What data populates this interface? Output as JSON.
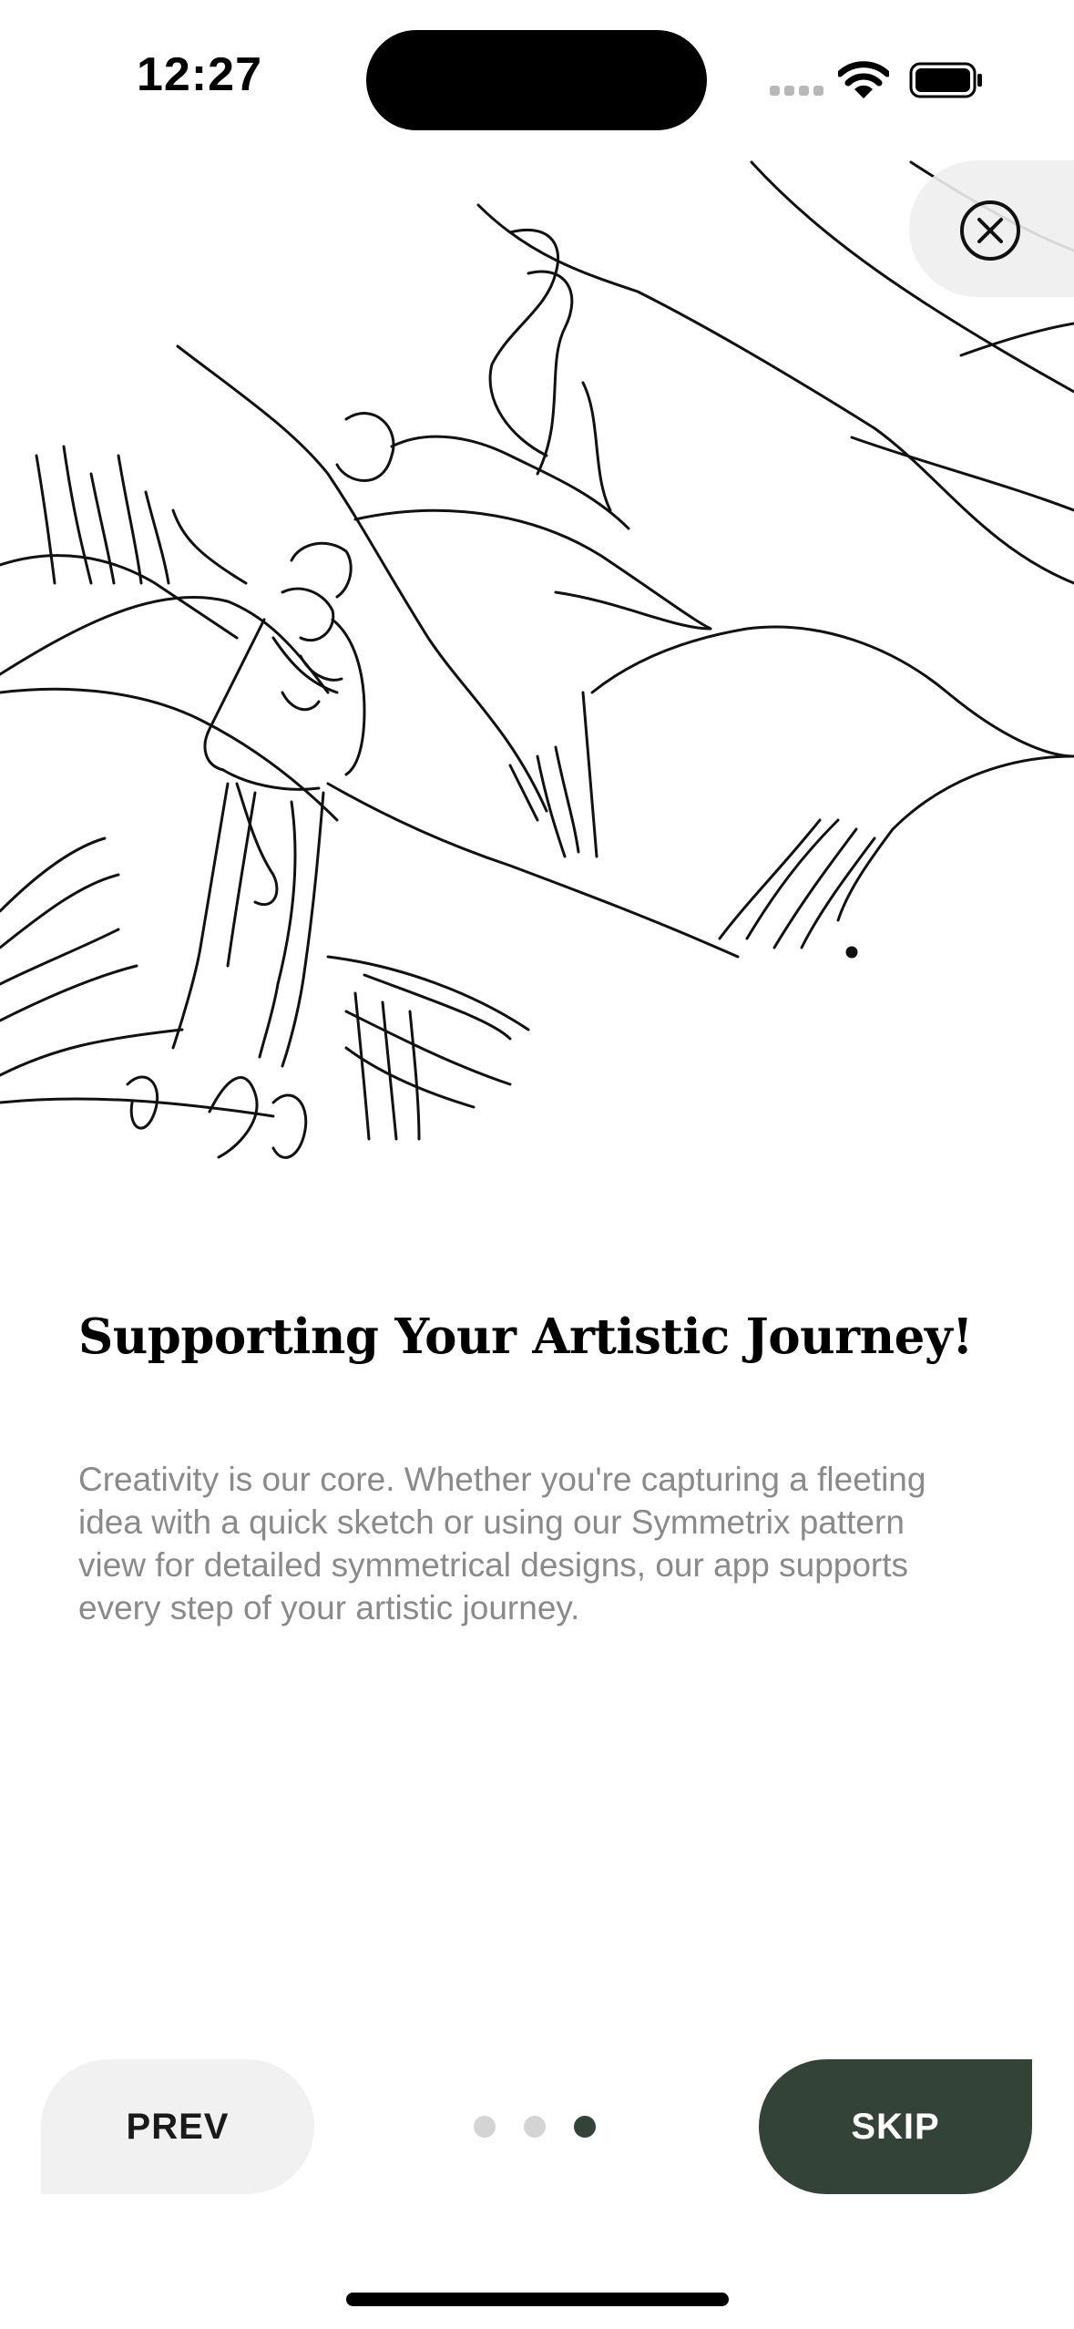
{
  "status_bar": {
    "time": "12:27",
    "icons": [
      "signal-icon",
      "wifi-icon",
      "battery-icon"
    ]
  },
  "hero": {
    "image": "pencil-sketch-hiker-in-mountains",
    "close_icon": "close-circle-icon"
  },
  "content": {
    "title": "Supporting Your Artistic Journey!",
    "description": "Creativity is our core. Whether you're capturing a fleeting idea with a quick sketch or using our Symmetrix pattern view for detailed symmetrical designs, our app supports every step of your artistic journey."
  },
  "navigation": {
    "prev_label": "PREV",
    "skip_label": "SKIP",
    "page_count": 3,
    "current_page": 3
  },
  "colors": {
    "accent": "#344337",
    "inactive_dot": "#d4d4d4",
    "secondary_button": "#f1f1f1",
    "body_text": "#8a8a8a"
  }
}
